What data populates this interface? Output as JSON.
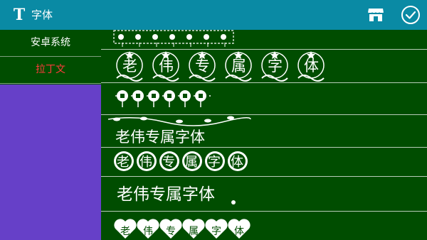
{
  "topbar": {
    "logo_letter": "T",
    "title": "字体",
    "background": "#0a8aa4",
    "icons": [
      "store-icon",
      "check-circle-icon"
    ]
  },
  "sidebar": {
    "items": [
      {
        "label": "安卓系统",
        "active": false
      },
      {
        "label": "拉丁文",
        "active": true
      }
    ],
    "active_color": "#ff3b3b",
    "fill_color": "#6640c8"
  },
  "font_list": {
    "sample_chars": [
      "老",
      "伟",
      "专",
      "属",
      "字",
      "体"
    ],
    "sample_text": "老伟专属字体",
    "rows": [
      {
        "style": "decorative-border-strip"
      },
      {
        "style": "star-crown-circles"
      },
      {
        "style": "lantern-ornaments"
      },
      {
        "style": "vine-swirl-plain"
      },
      {
        "style": "flower-ring-circles"
      },
      {
        "style": "brush-script-plain"
      },
      {
        "style": "heart-badges"
      }
    ]
  },
  "colors": {
    "panel_background": "#004d00",
    "text": "#ffffff"
  }
}
